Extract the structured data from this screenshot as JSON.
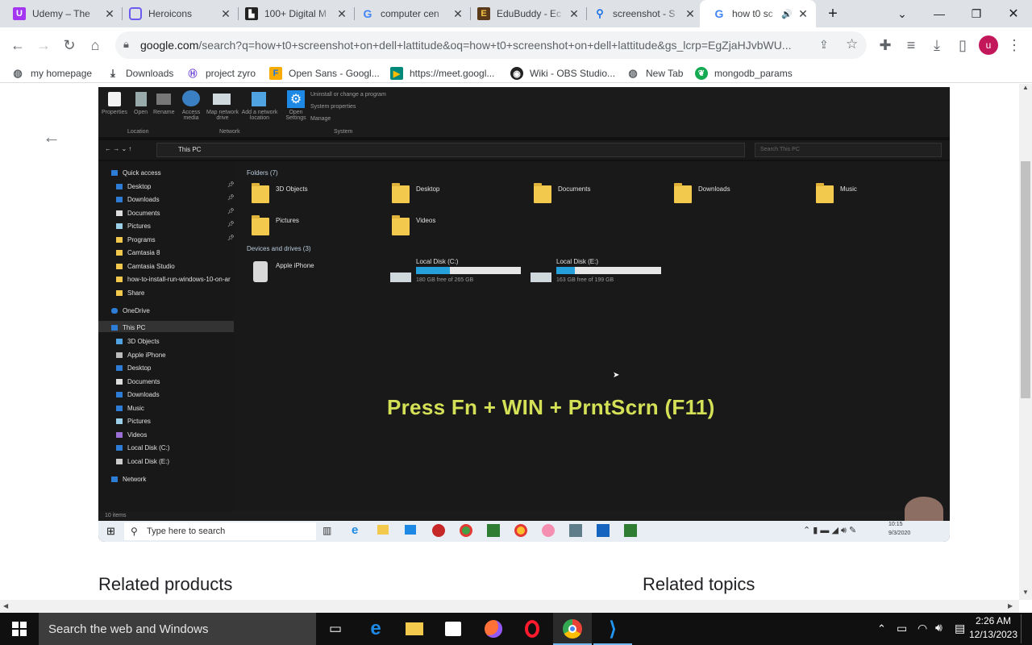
{
  "browser": {
    "tabs": [
      {
        "title": "Udemy – The",
        "favicon": "udemy-icon",
        "color": "#a435f0"
      },
      {
        "title": "Heroicons",
        "favicon": "heroicons-icon",
        "color": "#6b5cf0"
      },
      {
        "title": "100+ Digital M",
        "favicon": "digital-icon",
        "color": "#222222"
      },
      {
        "title": "computer cen",
        "favicon": "google-icon",
        "color": "#4285f4"
      },
      {
        "title": "EduBuddy - Ec",
        "favicon": "edubuddy-icon",
        "color": "#5a3a1a"
      },
      {
        "title": "screenshot - S",
        "favicon": "search-icon",
        "color": "#1a73e8"
      },
      {
        "title": "how t0 sc",
        "favicon": "google-icon",
        "color": "#4285f4"
      }
    ],
    "new_tab_label": "+",
    "url_host": "google.com",
    "url_rest": "/search?q=how+t0+screenshot+on+dell+lattitude&oq=how+t0+screenshot+on+dell+lattitude&gs_lcrp=EgZjaHJvbWU...",
    "profile_initial": "u",
    "profile_color": "#c2185b"
  },
  "bookmarks": [
    {
      "label": "my homepage",
      "icon": "globe-icon"
    },
    {
      "label": "Downloads",
      "icon": "download-icon"
    },
    {
      "label": "project zyro",
      "icon": "zyro-icon"
    },
    {
      "label": "Open Sans - Googl...",
      "icon": "google-fonts-icon"
    },
    {
      "label": "https://meet.googl...",
      "icon": "meet-icon"
    },
    {
      "label": "Wiki - OBS Studio...",
      "icon": "obs-icon"
    },
    {
      "label": "New Tab",
      "icon": "globe-icon"
    },
    {
      "label": "mongodb_params",
      "icon": "mongodb-icon"
    }
  ],
  "video": {
    "ribbon": {
      "buttons": [
        "Properties",
        "Open",
        "Rename",
        "Access media",
        "Map network drive",
        "Add a network location",
        "Open Settings"
      ],
      "system_links": [
        "Uninstall or change a program",
        "System properties",
        "Manage"
      ],
      "groups": [
        "Location",
        "Network",
        "System"
      ]
    },
    "address": "This PC",
    "search_placeholder": "Search This PC",
    "nav": {
      "quick_access": "Quick access",
      "quick_items": [
        "Desktop",
        "Downloads",
        "Documents",
        "Pictures",
        "Programs",
        "Camtasia 8",
        "Camtasia Studio",
        "how-to-install-run-windows-10-on-ar",
        "Share"
      ],
      "onedrive": "OneDrive",
      "this_pc": "This PC",
      "pc_items": [
        "3D Objects",
        "Apple iPhone",
        "Desktop",
        "Documents",
        "Downloads",
        "Music",
        "Pictures",
        "Videos",
        "Local Disk (C:)",
        "Local Disk (E:)"
      ],
      "network": "Network"
    },
    "folders_header": "Folders (7)",
    "folders": [
      "3D Objects",
      "Desktop",
      "Documents",
      "Downloads",
      "Music",
      "Pictures",
      "Videos"
    ],
    "devices_header": "Devices and drives (3)",
    "device": "Apple iPhone",
    "drives": [
      {
        "name": "Local Disk (C:)",
        "free": "180 GB free of 265 GB",
        "used_fraction": 0.32
      },
      {
        "name": "Local Disk (E:)",
        "free": "163 GB free of 199 GB",
        "used_fraction": 0.18
      }
    ],
    "status": "10 items",
    "caption": "Press Fn + WIN + PrntScrn (F11)",
    "caption_color": "#d4e157",
    "inner_taskbar_search": "Type here to search",
    "inner_clock_time": "10:15",
    "inner_clock_date": "9/3/2020"
  },
  "page": {
    "related_products": "Related products",
    "related_topics": "Related topics"
  },
  "taskbar": {
    "search_placeholder": "Search the web and Windows",
    "time": "2:26 AM",
    "date": "12/13/2023"
  }
}
